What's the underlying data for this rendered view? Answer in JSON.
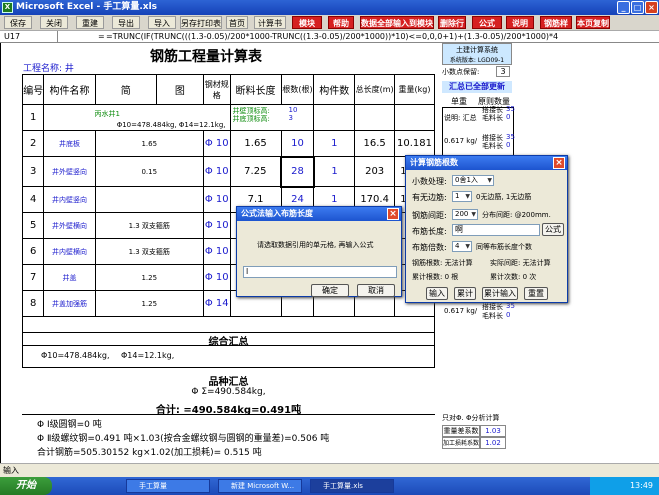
{
  "window": {
    "title": "Microsoft Excel - 手工算量.xls"
  },
  "toolbar": {
    "buttons": [
      {
        "label": "保存",
        "red": false
      },
      {
        "label": "关闭",
        "red": false
      },
      {
        "label": "重建",
        "red": false
      },
      {
        "label": "导出",
        "red": false
      },
      {
        "label": "导入",
        "red": false
      },
      {
        "label": "另存打印表",
        "red": false
      },
      {
        "label": "首页",
        "red": false
      },
      {
        "label": "计算书",
        "red": false
      },
      {
        "label": "模块",
        "red": true
      },
      {
        "label": "帮助",
        "red": true
      },
      {
        "label": "数据全部输入到模块内",
        "red": true
      },
      {
        "label": "删除行",
        "red": true
      },
      {
        "label": "公式",
        "red": true
      },
      {
        "label": "说明",
        "red": true
      },
      {
        "label": "钢筋样式",
        "red": true
      },
      {
        "label": "本页复制",
        "red": true
      }
    ]
  },
  "formula": {
    "cell": "U17",
    "fx": "=",
    "text": "=TRUNC(IF(TRUNC(((1.3-0.05)/200*1000-TRUNC((1.3-0.05)/200*1000))*10)<=0,0,0+1)+(1.3-0.05)/200*1000)*4"
  },
  "sheet": {
    "title": "钢筋工程量计算表",
    "project_label": "工程名称: 井",
    "headers": [
      "编号",
      "构件名称",
      "简",
      "图",
      "钢材规格",
      "断料长度",
      "根数(根)",
      "构件数",
      "总长度(m)",
      "重量(kg)"
    ],
    "row1": {
      "name": "丙水井1",
      "up_label": "井壁顶标高:",
      "up_val": "10",
      "down_label": "井底顶标高:",
      "down_val": "3",
      "summary": "Φ10=478.484kg, Φ14=12.1kg,"
    },
    "rows": [
      {
        "no": "2",
        "name": "井底板",
        "sub": "",
        "shape": "1.65",
        "spec": "Φ 10",
        "len": "1.65",
        "qty": "10",
        "count": "1",
        "total": "16.5",
        "weight": "10.181"
      },
      {
        "no": "3",
        "name": "井外壁竖向",
        "sub": "",
        "shape": "0.15",
        "spec": "Φ 10",
        "len": "7.25",
        "qty": "28",
        "count": "1",
        "total": "203",
        "weight": "125.2"
      },
      {
        "no": "4",
        "name": "井内壁竖向",
        "sub": "",
        "shape": "",
        "spec": "Φ 10",
        "len": "7.1",
        "qty": "24",
        "count": "1",
        "total": "170.4",
        "weight": "105.1"
      },
      {
        "no": "5",
        "name": "井外壁横向",
        "sub": "",
        "shape": "1.3 双支箍筋",
        "spec": "Φ 10",
        "len": "",
        "qty": "",
        "count": "",
        "total": "",
        "weight": ""
      },
      {
        "no": "6",
        "name": "井内壁横向",
        "sub": "",
        "shape": "1.3 双支箍筋",
        "spec": "Φ 10",
        "len": "",
        "qty": "",
        "count": "",
        "total": "",
        "weight": ""
      },
      {
        "no": "7",
        "name": "井盖",
        "sub": "",
        "shape": "1.25",
        "spec": "Φ 10",
        "len": "",
        "qty": "",
        "count": "",
        "total": "",
        "weight": ""
      },
      {
        "no": "8",
        "name": "井盖加强筋",
        "sub": "",
        "shape": "1.25",
        "spec": "Φ 14",
        "len": "",
        "qty": "",
        "count": "",
        "total": "",
        "weight": ""
      }
    ],
    "summary_title": "综合汇总",
    "summary_text": "Φ10=478.484kg,",
    "summary_text2": "Φ14=12.1kg,",
    "grade_title": "品种汇总",
    "grade_text": "Φ Σ=490.584kg,",
    "total_text": "合计: =490.584kg=0.491吨",
    "foot1": "Φ Ⅰ级圆钢=0 吨",
    "foot2": "Φ Ⅱ级螺纹钢=0.491 吨×1.03(按合金螺纹钢与圆钢的重量差)=0.506 吨",
    "foot3": "合计钢筋=505.30152 kg×1.02(加工损耗)= 0.515 吨"
  },
  "right": {
    "title1": "土建计算系统",
    "title2": "系统版本: LGD09-1",
    "decimals_label": "小数点保留:",
    "decimals_val": "3",
    "notice": "汇总已全部更新",
    "col_a": "单重",
    "col_b": "原则数量",
    "r1a": "说明: 汇总",
    "r1b": "搭接长",
    "r1c": "毛料长",
    "r1v1": "35",
    "r1v2": "0",
    "r2a": "0.617 kg/",
    "r2b": "搭接长",
    "r2c": "毛料长",
    "r2v1": "35",
    "r2v2": "0",
    "r3a": "0.617 kg/",
    "r3b": "搭接长",
    "r3c": "毛料长",
    "r3v1": "35",
    "r3v2": "0",
    "bottom_label": "只对Φ. Φ分析计算",
    "b1": "重量差系数",
    "b1v": "1.03",
    "b2": "加工损耗系数",
    "b2v": "1.02"
  },
  "dialog_calc": {
    "title": "计算钢筋根数",
    "decimal_label": "小数处理:",
    "decimal_val": "0舍1入",
    "edge_label": "有无边筋:",
    "edge_val": "1",
    "edge_hint": "0无边筋, 1无边筋",
    "spacing_label": "钢筋间距:",
    "spacing_val": "200",
    "spacing_hint": "分布间距: @200mm.",
    "len_label": "布筋长度:",
    "len_val": "啊",
    "formula_btn": "公式",
    "gap_label": "布筋倍数:",
    "gap_val": "4",
    "gap_hint": "同等布筋长度个数",
    "res_label": "钢筋根数: 无法计算",
    "res_label2": "实际间距: 无法计算",
    "acc_label": "累计根数: 0 根",
    "acc_label2": "累计次数: 0 次",
    "btn_input": "输入",
    "btn_acc": "累计",
    "btn_acc_input": "累计输入",
    "btn_reset": "重置"
  },
  "dialog_formula": {
    "title": "公式法输入布筋长度",
    "prompt": "请选取数据引用的单元格, 再输入公式",
    "input_val": "l",
    "ok": "确定",
    "cancel": "取消"
  },
  "status": {
    "text": "输入"
  },
  "taskbar": {
    "start": "开始",
    "items": [
      "手工算量",
      "新建 Microsoft W...",
      "手工算量.xls"
    ],
    "time": "13:49"
  }
}
